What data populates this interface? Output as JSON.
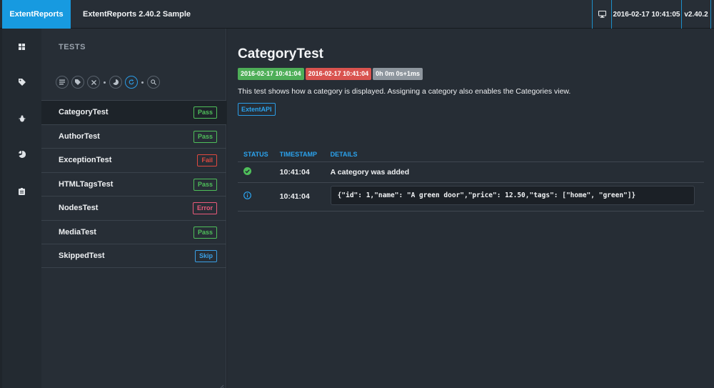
{
  "header": {
    "brand": "ExtentReports",
    "report_title": "ExtentReports 2.40.2 Sample",
    "icon": "monitor-icon",
    "datetime": "2016-02-17 10:41:05",
    "version": "v2.40.2"
  },
  "rail": {
    "items": [
      "dashboard-icon",
      "tag-icon",
      "bug-icon",
      "chart-icon",
      "clipboard-icon"
    ]
  },
  "tests_panel": {
    "title": "TESTS",
    "filters": [
      "list-icon",
      "tag-icon",
      "close-icon",
      "chart-icon",
      "refresh-icon",
      "search-icon"
    ],
    "items": [
      {
        "name": "CategoryTest",
        "status": "Pass",
        "selected": true
      },
      {
        "name": "AuthorTest",
        "status": "Pass"
      },
      {
        "name": "ExceptionTest",
        "status": "Fail"
      },
      {
        "name": "HTMLTagsTest",
        "status": "Pass"
      },
      {
        "name": "NodesTest",
        "status": "Error"
      },
      {
        "name": "MediaTest",
        "status": "Pass"
      },
      {
        "name": "SkippedTest",
        "status": "Skip"
      }
    ]
  },
  "details": {
    "title": "CategoryTest",
    "start_time": "2016-02-17 10:41:04",
    "end_time": "2016-02-17 10:41:04",
    "duration": "0h 0m 0s+1ms",
    "description": "This test shows how a category is displayed. Assigning a category also enables the Categories view.",
    "category": "ExtentAPI",
    "log_headers": {
      "status": "STATUS",
      "timestamp": "TIMESTAMP",
      "details": "DETAILS"
    },
    "logs": [
      {
        "status": "pass",
        "status_icon": "check-circle-icon",
        "timestamp": "10:41:04",
        "details": "A category was added"
      },
      {
        "status": "info",
        "status_icon": "info-circle-icon",
        "timestamp": "10:41:04",
        "details": "{\"id\": 1,\"name\": \"A green door\",\"price\": 12.50,\"tags\": [\"home\", \"green\"]}"
      }
    ]
  },
  "colors": {
    "accent": "#179ae0",
    "pass": "#4fbf5a",
    "fail": "#e0493f",
    "error": "#ea5a7a",
    "skip": "#3aa0e6",
    "background": "#262d35"
  }
}
